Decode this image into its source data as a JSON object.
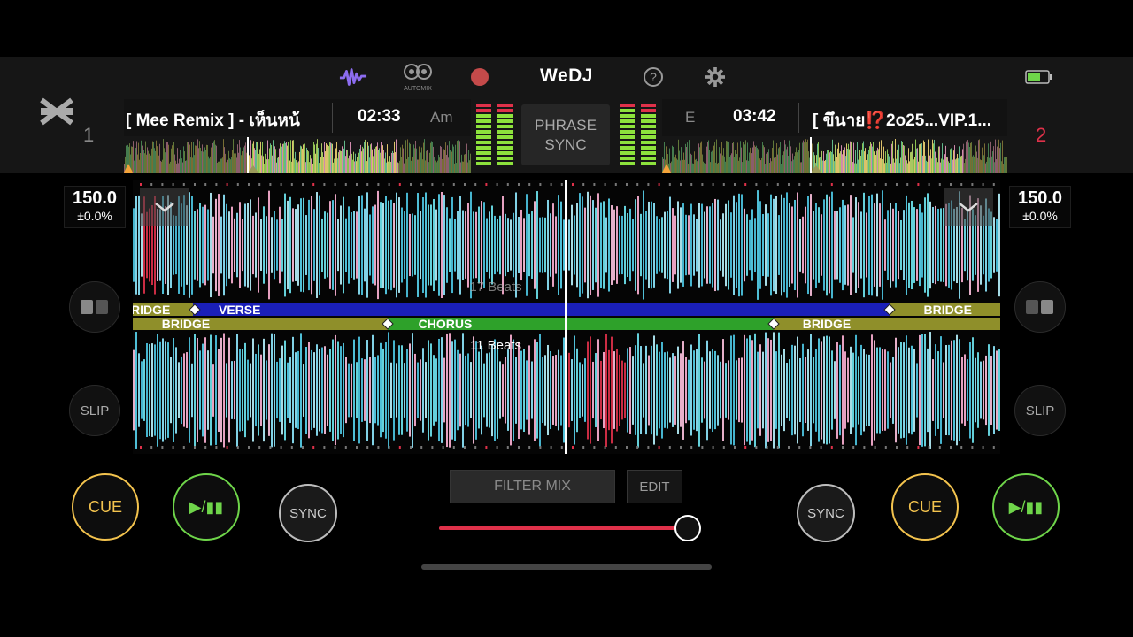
{
  "header": {
    "logo": "WeDJ",
    "automix_label": "AUTOMIX",
    "icons": [
      "waveform-icon",
      "automix-icon",
      "record-icon",
      "help-icon",
      "settings-icon",
      "battery-icon"
    ],
    "colors": {
      "waveform_icon": "#8c6cf0",
      "record": "#c44a4a",
      "battery": "#6fd54a"
    }
  },
  "deck1": {
    "number": "1",
    "title": "[ Mee Remix ] - เห็นหน้",
    "time": "02:33",
    "key": "Am",
    "bpm": "150.0",
    "pitch": "±0.0%",
    "beats_label": "17 Beats",
    "cue_label": "CUE",
    "play_label": "▶/▮▮",
    "sync_label": "SYNC",
    "slip_label": "SLIP",
    "phrases": [
      "RIDGE",
      "VERSE"
    ],
    "right_phrase": "BRIDGE"
  },
  "deck2": {
    "number": "2",
    "title": "[ ขึนาย⁉️2o25...VIP.1...",
    "time": "03:42",
    "key": "E",
    "bpm": "150.0",
    "pitch": "±0.0%",
    "beats_label": "11 Beats",
    "cue_label": "CUE",
    "play_label": "▶/▮▮",
    "sync_label": "SYNC",
    "slip_label": "SLIP",
    "phrases": [
      "BRIDGE",
      "CHORUS",
      "BRIDGE"
    ]
  },
  "mixer": {
    "phrase_sync_line1": "PHRASE",
    "phrase_sync_line2": "SYNC",
    "filter_mix_label": "FILTER MIX",
    "edit_label": "EDIT",
    "crossfader_position": 0.99
  },
  "colors": {
    "cue": "#f3c34e",
    "play": "#6fd54a",
    "deck2_number": "#e0314a",
    "verse": "#1a1fb8",
    "bridge": "#8f8f2a",
    "chorus": "#2ea12a"
  }
}
